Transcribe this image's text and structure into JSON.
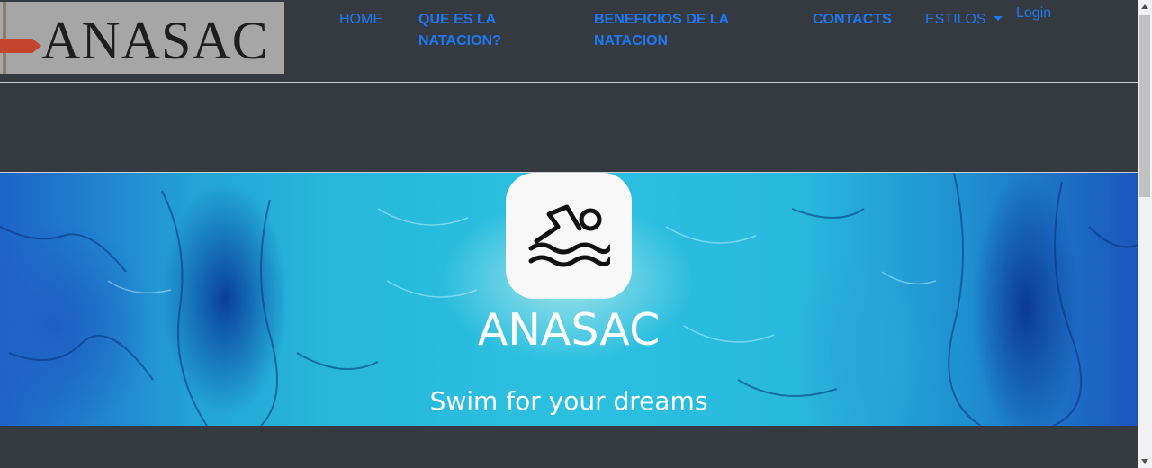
{
  "brand": {
    "logo_text": "ANASAC"
  },
  "nav": {
    "home": "HOME",
    "que_es": "QUE ES LA NATACION?",
    "beneficios": "BENEFICIOS DE LA NATACION",
    "contacts": "CONTACTS",
    "estilos": "ESTILOS",
    "login": "Login"
  },
  "hero": {
    "icon": "swimmer-icon",
    "title": "ANASAC",
    "subtitle": "Swim for your dreams"
  },
  "colors": {
    "page_background": "#343a40",
    "nav_link": "#1f78f3",
    "hero_text": "#ffffff",
    "icon_box": "#f8f8f8"
  }
}
